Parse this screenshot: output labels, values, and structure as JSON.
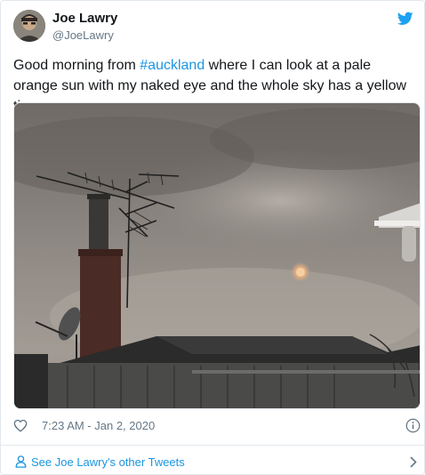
{
  "user": {
    "display_name": "Joe Lawry",
    "handle": "@JoeLawry"
  },
  "icons": {
    "brand": "twitter-bird-icon",
    "like": "heart-outline-icon",
    "info": "info-circle-icon",
    "profile": "person-icon",
    "chevron": "chevron-right-icon"
  },
  "tweet": {
    "text_before": "Good morning from ",
    "hashtag": "#auckland",
    "text_after": " where I can look at a pale orange sun with my naked eye and the whole sky has a yellow tinge",
    "timestamp": "7:23 AM - Jan 2, 2020"
  },
  "footer": {
    "more_tweets_label": "See Joe Lawry's other Tweets"
  },
  "colors": {
    "link_blue": "#1b95e0",
    "twitter_blue": "#1da1f2",
    "text_primary": "#14171a",
    "text_secondary": "#657786"
  }
}
